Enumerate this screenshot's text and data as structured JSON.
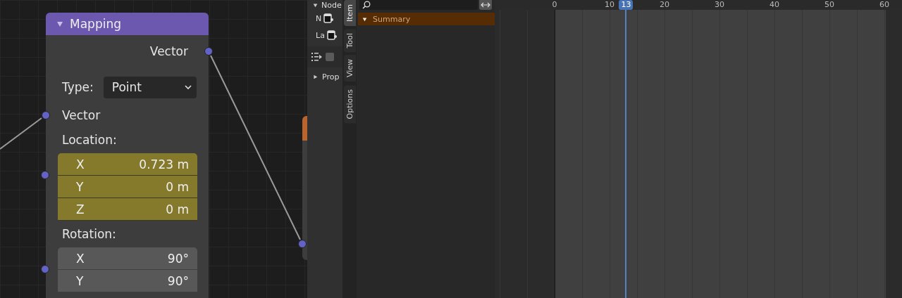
{
  "node": {
    "title": "Mapping",
    "expanded": true,
    "output": "Vector",
    "type_label": "Type:",
    "type_value": "Point",
    "input": "Vector",
    "location": {
      "label": "Location:",
      "keyframed": true,
      "fields": [
        {
          "axis": "X",
          "value": "0.723 m"
        },
        {
          "axis": "Y",
          "value": "0 m"
        },
        {
          "axis": "Z",
          "value": "0 m"
        }
      ]
    },
    "rotation": {
      "label": "Rotation:",
      "keyframed": false,
      "fields": [
        {
          "axis": "X",
          "value": "90°"
        },
        {
          "axis": "Y",
          "value": "90°"
        }
      ]
    }
  },
  "sidebar": {
    "panel": {
      "title": "Node",
      "expanded": true
    },
    "rows": [
      {
        "label": "N"
      },
      {
        "label": "La"
      }
    ],
    "checkbox": {
      "checked": false
    },
    "subpanel": {
      "title": "Prop",
      "expanded": false
    },
    "tabs": [
      {
        "label": "Item",
        "selected": true
      },
      {
        "label": "Tool",
        "selected": false
      },
      {
        "label": "View",
        "selected": false
      },
      {
        "label": "Options",
        "selected": false
      }
    ]
  },
  "channels": {
    "items": [
      {
        "label": "Summary",
        "expanded": true
      }
    ]
  },
  "timeline": {
    "frame_labels": [
      "0",
      "10",
      "20",
      "30",
      "40",
      "50",
      "60"
    ],
    "current_frame": "13"
  }
}
